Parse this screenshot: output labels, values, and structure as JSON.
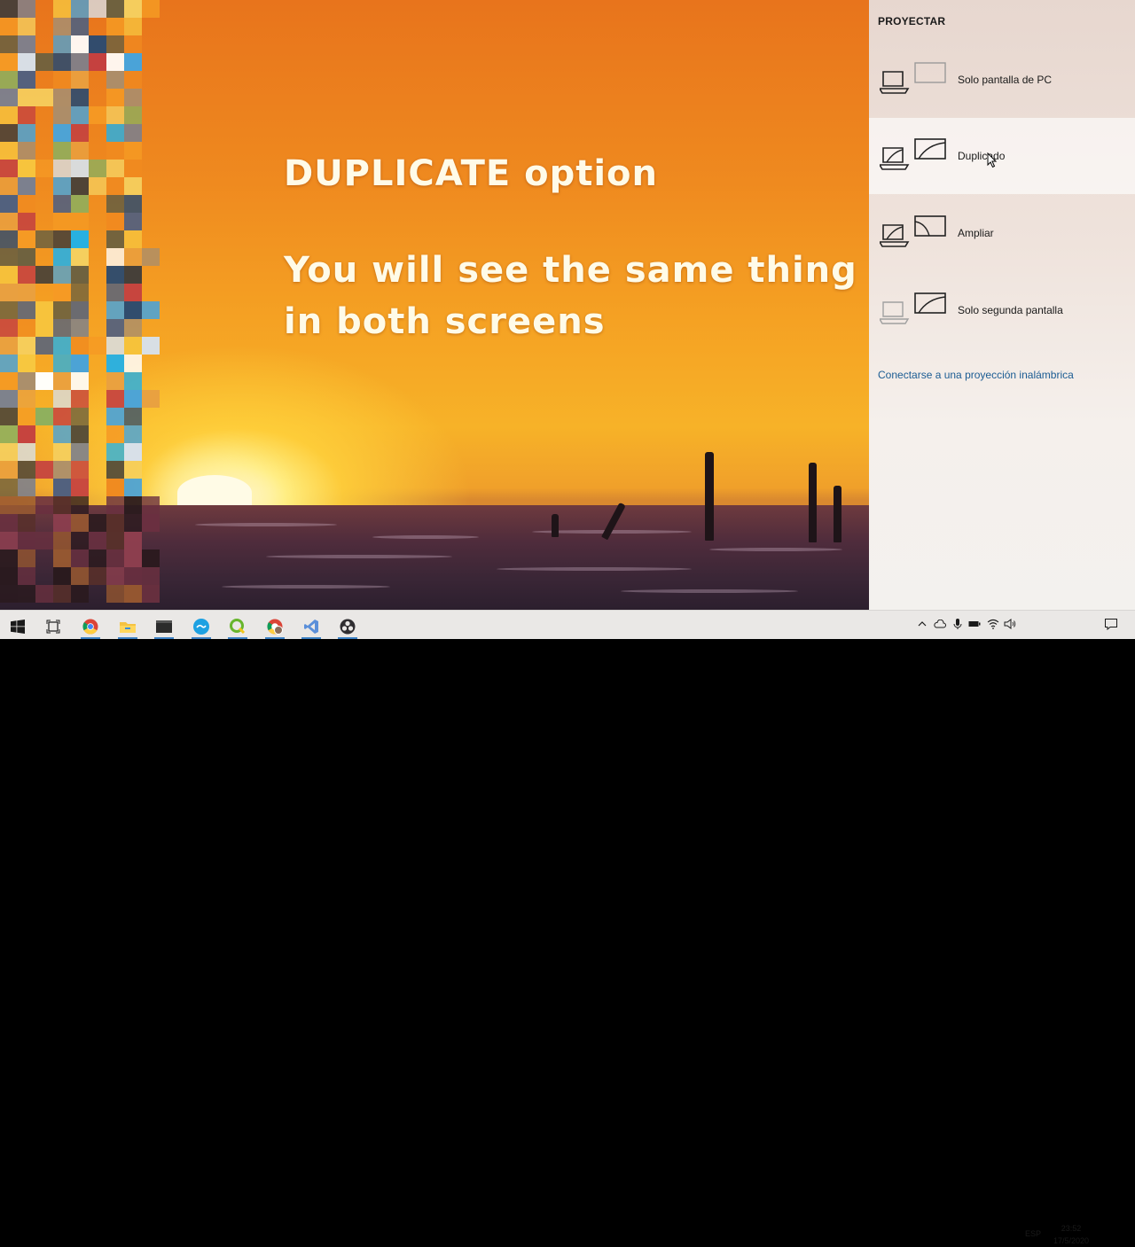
{
  "overlay": {
    "title": "DUPLICATE option",
    "body_line1": "You will see the same thing",
    "body_line2": "in both screens"
  },
  "project_panel": {
    "heading": "PROYECTAR",
    "options": [
      {
        "label": "Solo pantalla de PC",
        "icon": "pc-screen-only-icon"
      },
      {
        "label": "Duplicado",
        "icon": "duplicate-icon",
        "hovered": true
      },
      {
        "label": "Ampliar",
        "icon": "extend-icon"
      },
      {
        "label": "Solo segunda pantalla",
        "icon": "second-screen-only-icon"
      }
    ],
    "wireless_link": "Conectarse a una proyección inalámbrica"
  },
  "taskbar": {
    "apps": [
      "windows-start-icon",
      "task-view-icon",
      "chrome-icon",
      "file-explorer-icon",
      "terminal-icon",
      "app-blue-icon",
      "qgis-icon",
      "chrome-profile-icon",
      "visual-studio-icon",
      "obs-icon"
    ],
    "tray": {
      "language": "ESP",
      "time": "23:52",
      "date": "17/5/2020"
    }
  },
  "colors": {
    "link": "#1b5c93",
    "hover_bg": "#fbf7f5",
    "taskbar": "#eae8e6"
  }
}
